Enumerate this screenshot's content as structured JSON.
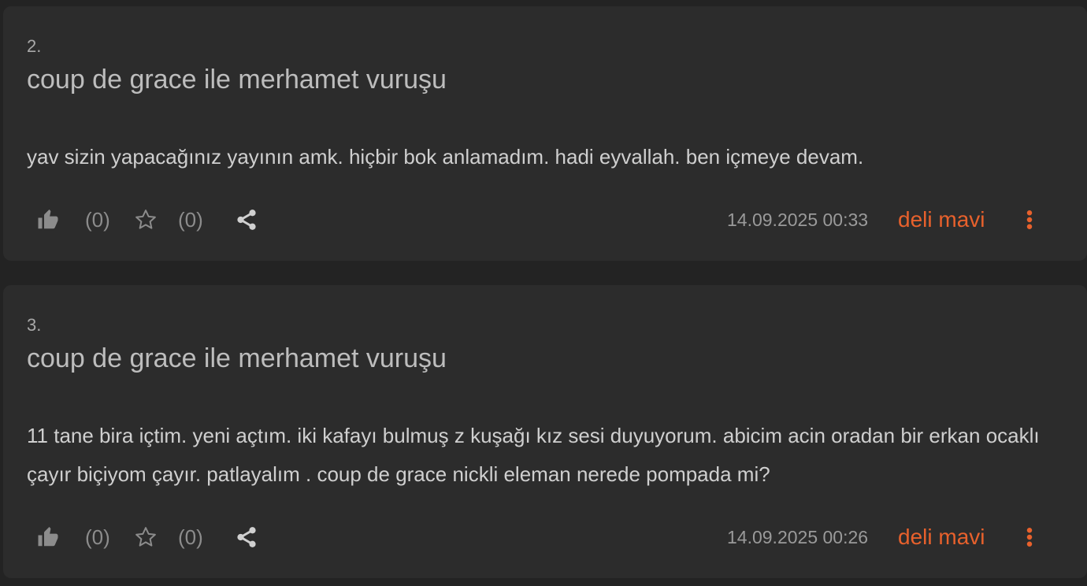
{
  "entries": [
    {
      "number": "2.",
      "title": "coup de grace ile merhamet vuruşu",
      "content": "yav sizin yapacağınız yayının amk. hiçbir bok anlamadım. hadi eyvallah. ben içmeye devam.",
      "like_count": "(0)",
      "fav_count": "(0)",
      "date": "14.09.2025 00:33",
      "author": "deli mavi"
    },
    {
      "number": "3.",
      "title": "coup de grace ile merhamet vuruşu",
      "content": "11 tane bira içtim. yeni açtım. iki kafayı bulmuş z kuşağı kız sesi duyuyorum. abicim acin oradan bir erkan ocaklı çayır biçiyom çayır. patlayalım . coup de grace nickli eleman nerede pompada mi?",
      "like_count": "(0)",
      "fav_count": "(0)",
      "date": "14.09.2025 00:26",
      "author": "deli mavi"
    }
  ],
  "icons": {
    "like": "thumbs-up-icon",
    "favorite": "star-icon",
    "share": "share-icon",
    "menu": "more-vertical-icon"
  },
  "colors": {
    "background": "#232323",
    "card": "#2c2c2c",
    "author": "#e8612c"
  }
}
